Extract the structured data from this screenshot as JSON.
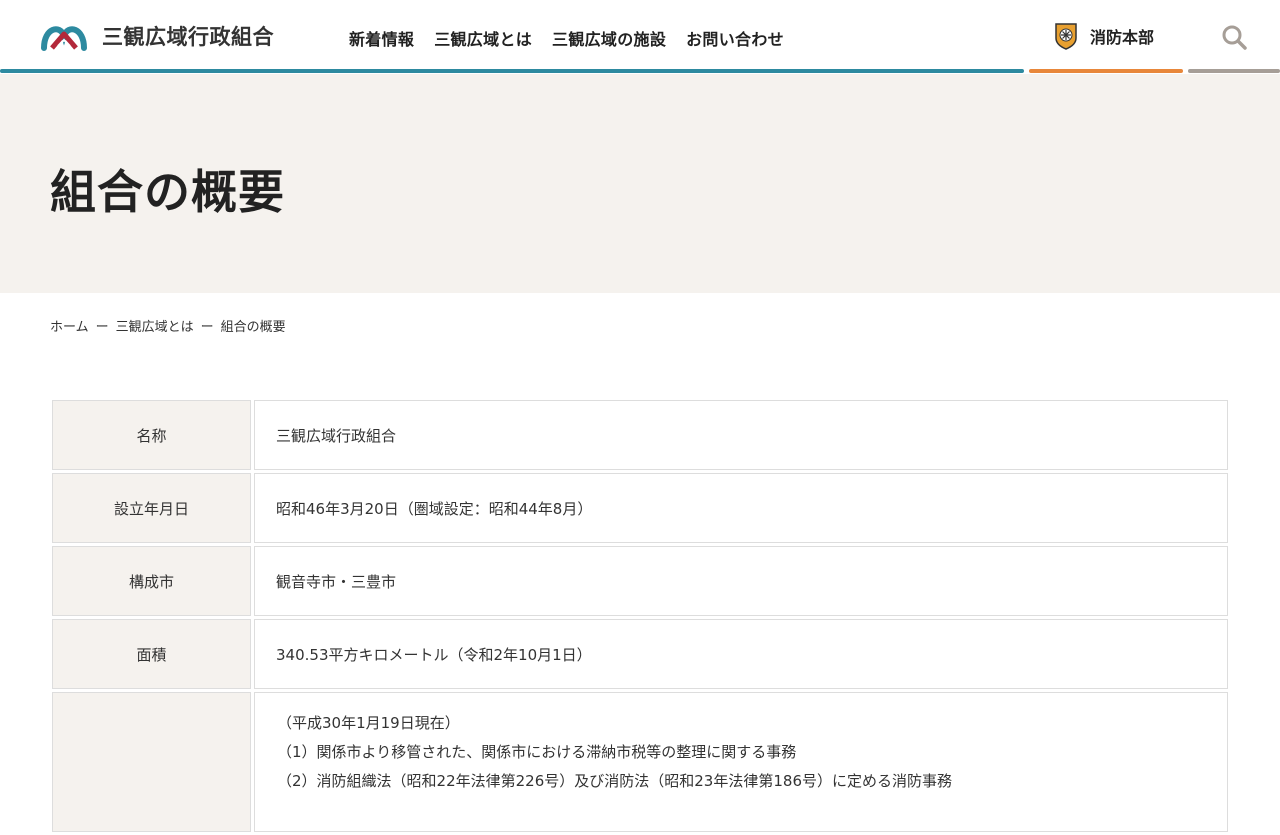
{
  "header": {
    "logo_text": "三観広域行政組合",
    "nav": [
      "新着情報",
      "三観広域とは",
      "三観広域の施設",
      "お問い合わせ"
    ],
    "fire_label": "消防本部",
    "colors": {
      "main_bar": "#2d8aa0",
      "fire_bar": "#e8873a",
      "search_bar": "#a69e97",
      "logo_teal": "#2d8aa0",
      "logo_red": "#b3283a"
    }
  },
  "hero": {
    "title": "組合の概要"
  },
  "breadcrumb": {
    "items": [
      "ホーム",
      "三観広域とは",
      "組合の概要"
    ],
    "separator": "ー"
  },
  "table": {
    "rows": [
      {
        "label": "名称",
        "value": "三観広域行政組合"
      },
      {
        "label": "設立年月日",
        "value": "昭和46年3月20日（圏域設定：昭和44年8月）"
      },
      {
        "label": "構成市",
        "value": "観音寺市・三豊市"
      },
      {
        "label": "面積",
        "value": "340.53平方キロメートル（令和2年10月1日）"
      },
      {
        "label": "",
        "lines": [
          "（平成30年1月19日現在）",
          "（1）関係市より移管された、関係市における滞納市税等の整理に関する事務",
          "（2）消防組織法（昭和22年法律第226号）及び消防法（昭和23年法律第186号）に定める消防事務"
        ]
      }
    ]
  }
}
